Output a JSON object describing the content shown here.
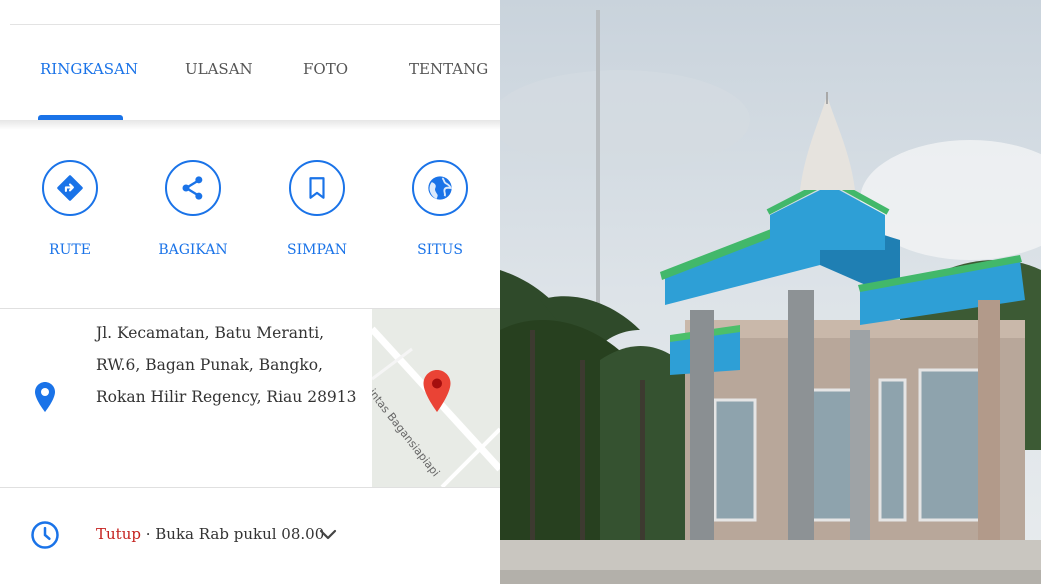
{
  "tabs": [
    {
      "label": "RINGKASAN",
      "active": true
    },
    {
      "label": "ULASAN"
    },
    {
      "label": "FOTO"
    },
    {
      "label": "TENTANG"
    }
  ],
  "actions": [
    {
      "label": "RUTE",
      "icon": "directions-icon"
    },
    {
      "label": "BAGIKAN",
      "icon": "share-icon"
    },
    {
      "label": "SIMPAN",
      "icon": "bookmark-icon"
    },
    {
      "label": "SITUS",
      "icon": "globe-icon"
    }
  ],
  "address": {
    "text": "Jl. Kecamatan, Batu Meranti, RW.6, Bagan Punak, Bangko, Rokan Hilir Regency, Riau 28913",
    "map_road": "Jl. Lintas Bagansiapiapi"
  },
  "hours": {
    "status": "Tutup",
    "separator": " · ",
    "next_open": "Buka Rab pukul 08.00"
  },
  "colors": {
    "accent": "#1a73e8",
    "closed": "#c5221f",
    "map_pin": "#ea4335"
  }
}
